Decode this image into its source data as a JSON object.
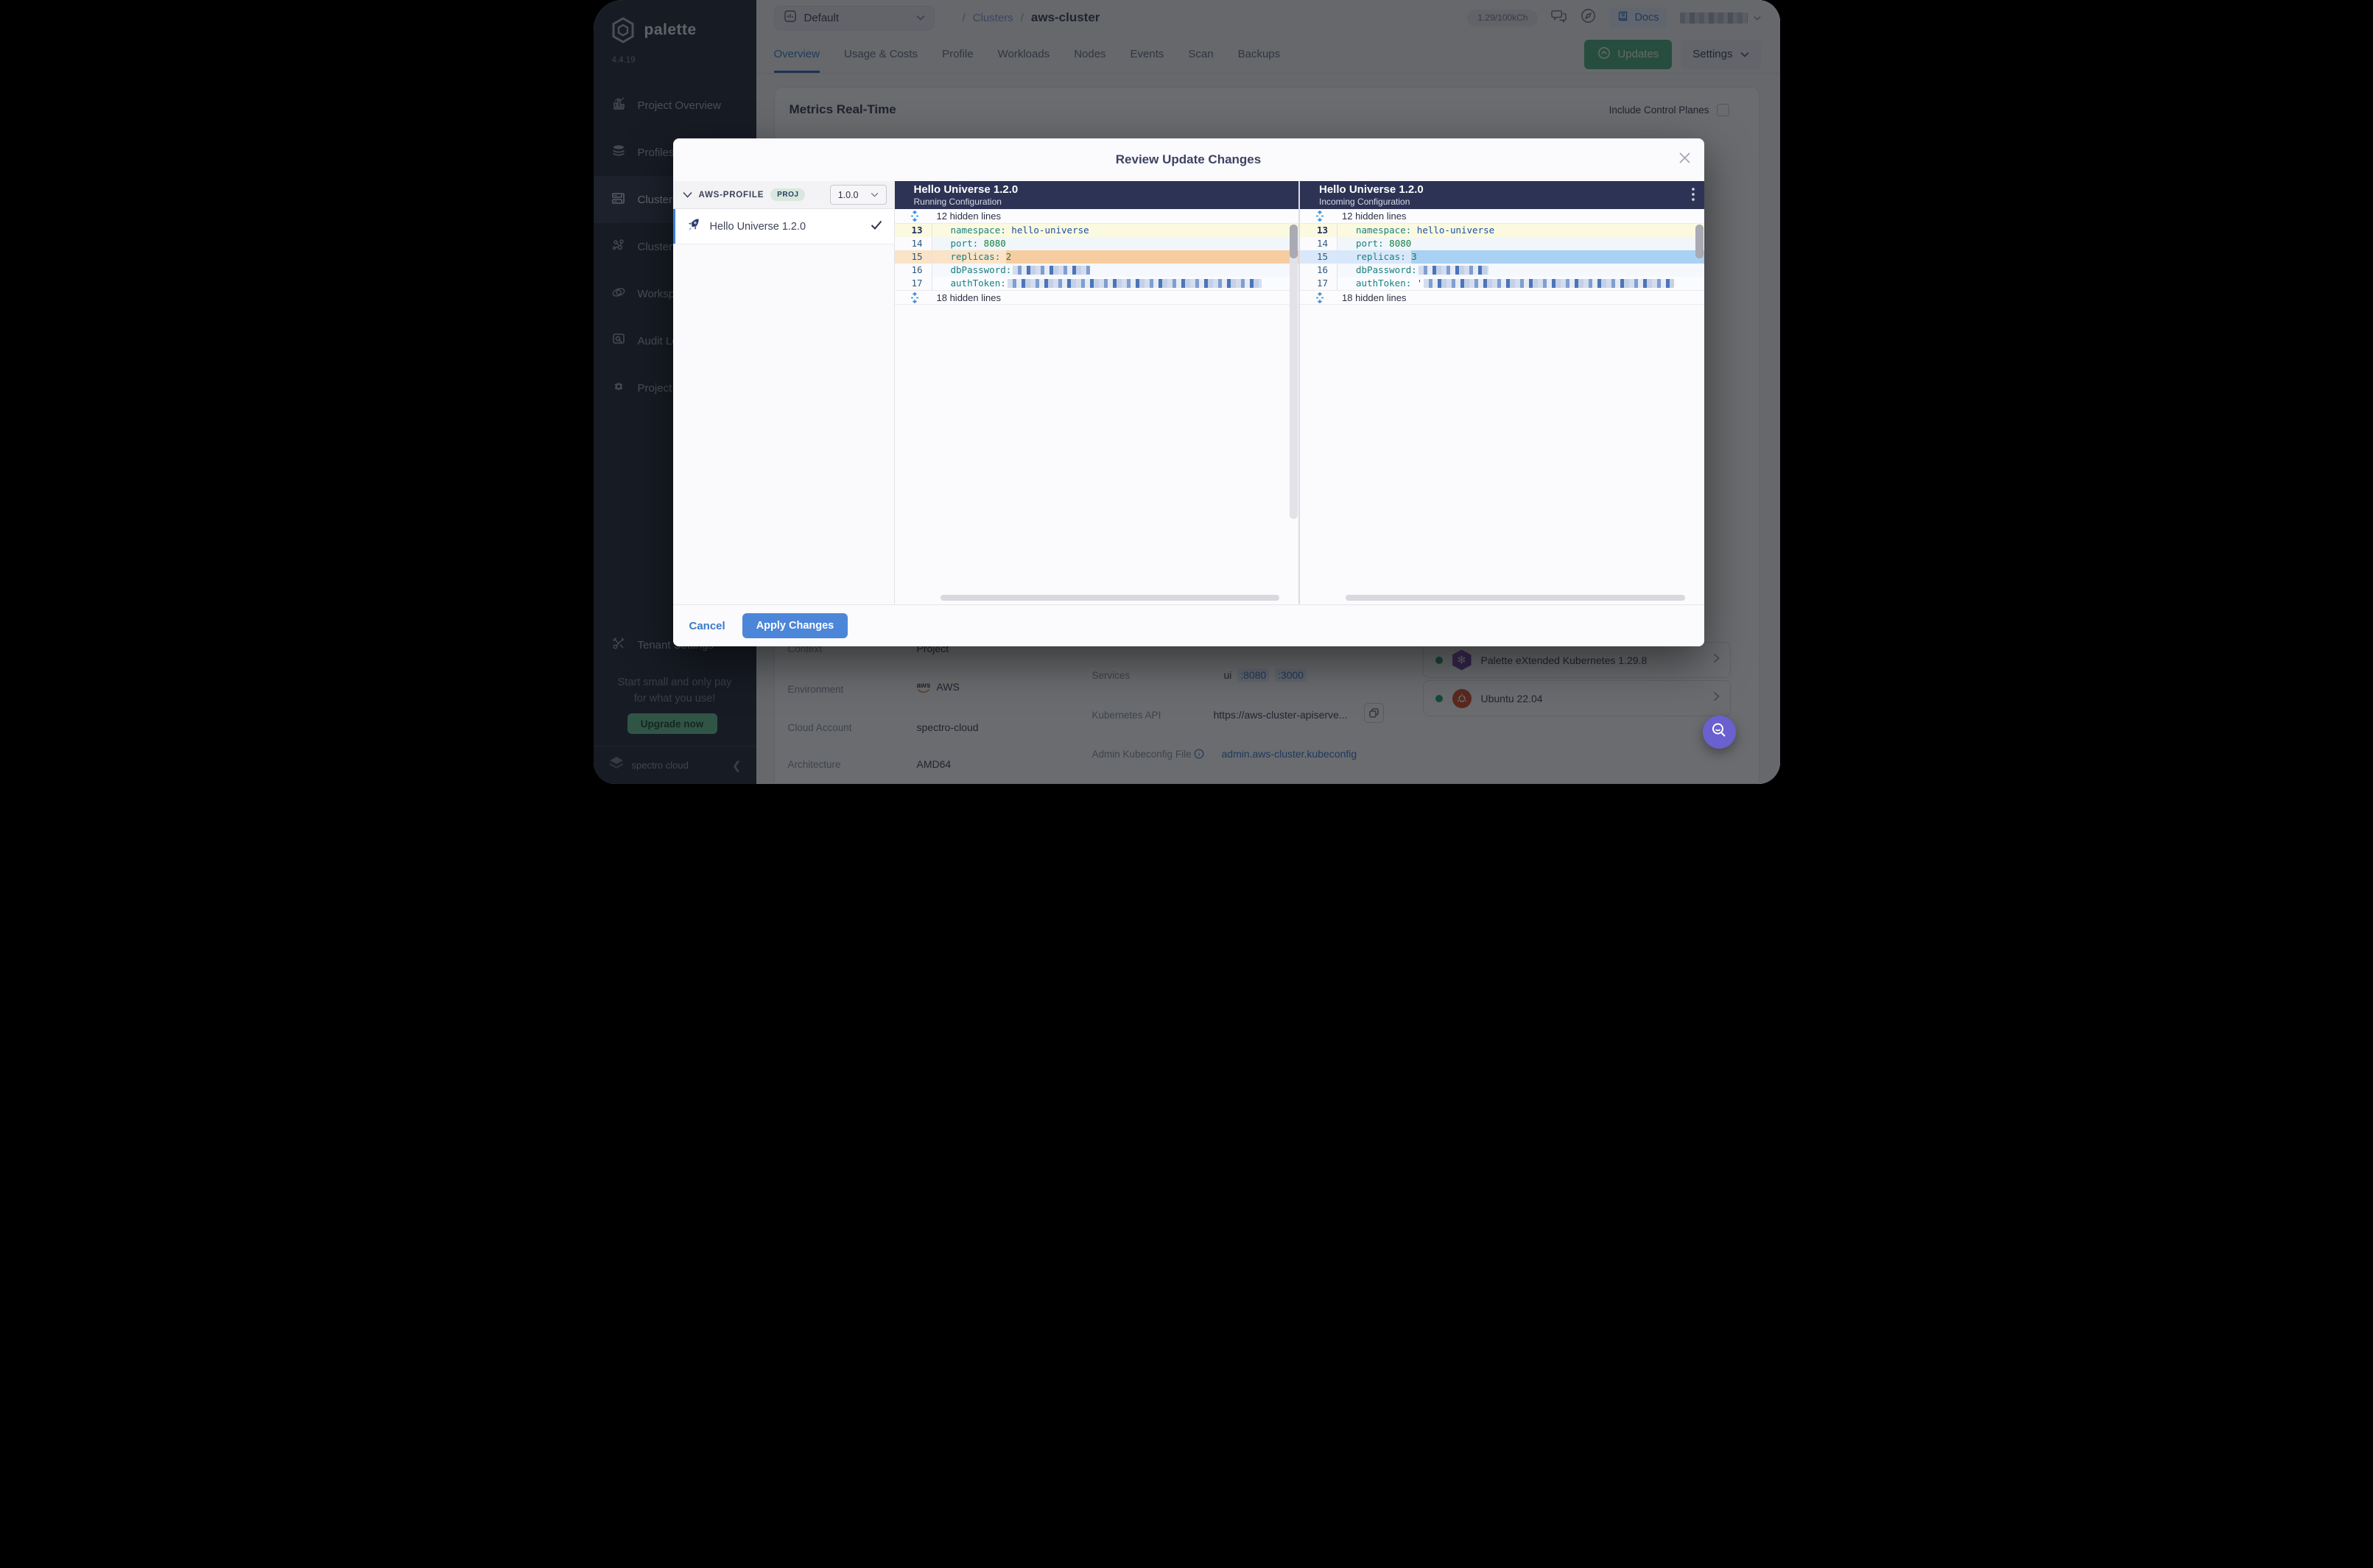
{
  "app": {
    "brand": "palette",
    "version": "4.4.19",
    "footer_brand": "spectro cloud"
  },
  "sidebar": {
    "items": [
      {
        "label": "Project Overview"
      },
      {
        "label": "Profiles"
      },
      {
        "label": "Clusters",
        "active": true
      },
      {
        "label": "Cluster Groups"
      },
      {
        "label": "Workspaces"
      },
      {
        "label": "Audit Logs"
      },
      {
        "label": "Project Settings"
      }
    ],
    "tenant_settings": "Tenant Settings",
    "promo_line1": "Start small and only pay",
    "promo_line2": "for what you use!",
    "upgrade_label": "Upgrade now"
  },
  "header": {
    "project_selector": "Default",
    "breadcrumb_sep": "/",
    "breadcrumb_link": "Clusters",
    "breadcrumb_current": "aws-cluster",
    "usage_badge": "1.29/100kCh",
    "docs_label": "Docs"
  },
  "tabs": [
    {
      "label": "Overview"
    },
    {
      "label": "Usage & Costs"
    },
    {
      "label": "Profile"
    },
    {
      "label": "Workloads"
    },
    {
      "label": "Nodes"
    },
    {
      "label": "Events"
    },
    {
      "label": "Scan"
    },
    {
      "label": "Backups"
    }
  ],
  "actions": {
    "updates": "Updates",
    "settings": "Settings"
  },
  "content": {
    "metrics_title": "Metrics Real-Time",
    "include_control_planes": "Include Control Planes",
    "details_left": [
      {
        "label": "Context",
        "value": "Project"
      },
      {
        "label": "Environment",
        "value": "AWS"
      },
      {
        "label": "Cloud Account",
        "value": "spectro-cloud"
      },
      {
        "label": "Architecture",
        "value": "AMD64"
      }
    ],
    "services": {
      "label": "Services",
      "prefix": "ui",
      "link1": ":8080",
      "link2": ":3000"
    },
    "kubernetes_api": {
      "label": "Kubernetes API",
      "value": "https://aws-cluster-apiserve..."
    },
    "kubeconfig": {
      "label": "Admin Kubeconfig File",
      "value": "admin.aws-cluster.kubeconfig"
    },
    "packs": [
      {
        "name": "Palette eXtended Kubernetes 1.29.8"
      },
      {
        "name": "Ubuntu 22.04"
      }
    ]
  },
  "modal": {
    "title": "Review Update Changes",
    "profile_group": {
      "name": "AWS-PROFILE",
      "scope_badge": "PROJ",
      "version": "1.0.0"
    },
    "profile_item": {
      "name": "Hello Universe 1.2.0"
    },
    "cancel": "Cancel",
    "apply": "Apply Changes",
    "panels": [
      {
        "title": "Hello Universe 1.2.0",
        "subtitle": "Running Configuration",
        "hidden_top": "12 hidden lines",
        "hidden_bottom": "18 hidden lines",
        "lines": [
          {
            "no": "13",
            "k": "namespace:",
            "v": "hello-universe"
          },
          {
            "no": "14",
            "k": "port:",
            "v": "8080"
          },
          {
            "no": "15",
            "k": "replicas:",
            "v": "2"
          },
          {
            "no": "16",
            "k": "dbPassword:"
          },
          {
            "no": "17",
            "k": "authToken:"
          }
        ]
      },
      {
        "title": "Hello Universe 1.2.0",
        "subtitle": "Incoming Configuration",
        "hidden_top": "12 hidden lines",
        "hidden_bottom": "18 hidden lines",
        "lines": [
          {
            "no": "13",
            "k": "namespace:",
            "v": "hello-universe"
          },
          {
            "no": "14",
            "k": "port:",
            "v": "8080"
          },
          {
            "no": "15",
            "k": "replicas:",
            "v": "3"
          },
          {
            "no": "16",
            "k": "dbPassword:"
          },
          {
            "no": "17",
            "k": "authToken:",
            "v": "'"
          }
        ]
      }
    ]
  }
}
